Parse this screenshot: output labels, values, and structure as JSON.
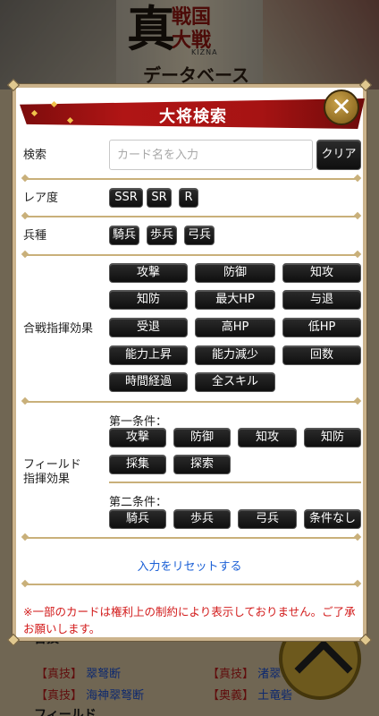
{
  "background": {
    "logo_main": "真",
    "logo_sub": "戦国大戦",
    "logo_tag": "KIZNA",
    "subtitle": "データベース",
    "section1_title": "合技",
    "section2_title": "フィールド",
    "rows": [
      {
        "tag": "【真技】",
        "name": "翠弩断"
      },
      {
        "tag": "【真技】",
        "name": "渚翠弩"
      },
      {
        "tag": "【真技】",
        "name": "海神翠弩断"
      },
      {
        "tag": "【奥義】",
        "name": "土竜砦"
      }
    ]
  },
  "modal": {
    "title": "大将検索",
    "close_label": "✕",
    "search": {
      "label": "検索",
      "placeholder": "カード名を入力",
      "value": "",
      "clear_label": "クリア"
    },
    "rarity": {
      "label": "レア度",
      "options": [
        "SSR",
        "SR",
        "R"
      ]
    },
    "troop": {
      "label": "兵種",
      "options": [
        "騎兵",
        "歩兵",
        "弓兵"
      ]
    },
    "battle_effect": {
      "label": "合戦指揮効果",
      "options": [
        "攻撃",
        "防御",
        "知攻",
        "知防",
        "最大HP",
        "与退",
        "受退",
        "高HP",
        "低HP",
        "能力上昇",
        "能力減少",
        "回数",
        "時間経過",
        "全スキル"
      ]
    },
    "field_effect": {
      "label_line1": "フィールド",
      "label_line2": "指揮効果",
      "first_condition_label": "第一条件：",
      "first_options": [
        "攻撃",
        "防御",
        "知攻",
        "知防",
        "採集",
        "探索"
      ],
      "second_condition_label": "第二条件：",
      "second_options": [
        "騎兵",
        "歩兵",
        "弓兵",
        "条件なし"
      ]
    },
    "reset_label": "入力をリセットする",
    "notice": "※一部のカードは権利上の制約により表示しておりません。ご了承お願いします。"
  },
  "colors": {
    "banner_red": "#a61313",
    "button_black": "#111111",
    "divider_gold": "#c9b07a",
    "link_blue": "#1a5fd6",
    "notice_red": "#d21a1a"
  }
}
